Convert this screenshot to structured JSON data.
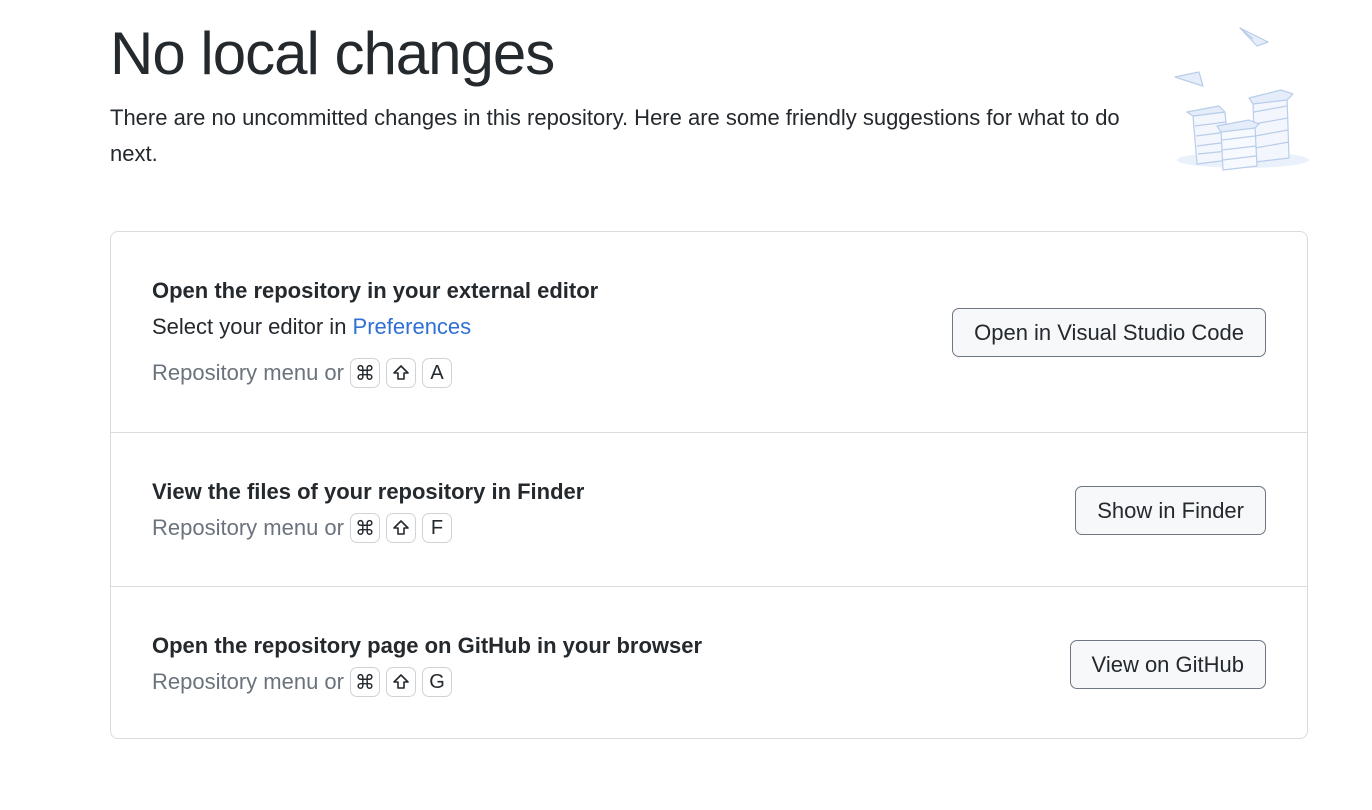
{
  "header": {
    "title": "No local changes",
    "subtitle": "There are no uncommitted changes in this repository. Here are some friendly suggestions for what to do next."
  },
  "illustration": {
    "icon": "paper-stacks-illustration",
    "color": "#c8d9f0"
  },
  "actions": [
    {
      "heading": "Open the repository in your external editor",
      "description_prefix": "Select your editor in ",
      "description_link": "Preferences",
      "shortcut_prefix": "Repository menu or",
      "keys": [
        "⌘",
        "shift",
        "A"
      ],
      "button": "Open in Visual Studio Code"
    },
    {
      "heading": "View the files of your repository in Finder",
      "shortcut_prefix": "Repository menu or",
      "keys": [
        "⌘",
        "shift",
        "F"
      ],
      "button": "Show in Finder"
    },
    {
      "heading": "Open the repository page on GitHub in your browser",
      "shortcut_prefix": "Repository menu or",
      "keys": [
        "⌘",
        "shift",
        "G"
      ],
      "button": "View on GitHub"
    }
  ],
  "colors": {
    "link": "#2f6fd6",
    "muted_text": "#6a737d",
    "border": "#d9dcdf",
    "button_bg": "#f6f8fa"
  }
}
